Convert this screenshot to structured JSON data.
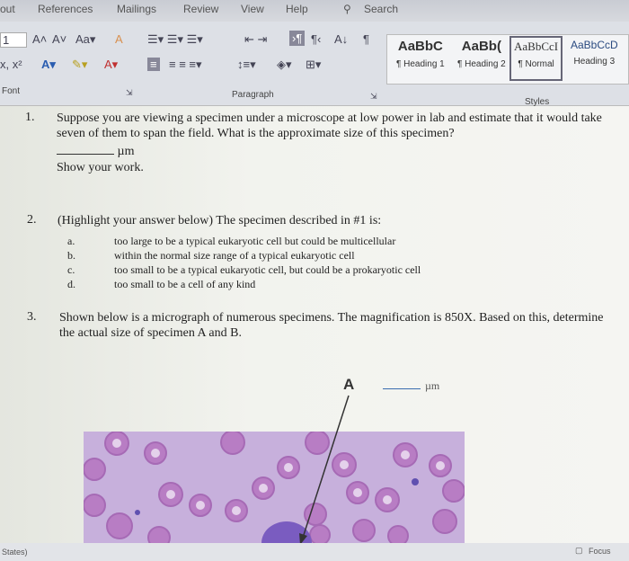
{
  "tabs": [
    "out",
    "References",
    "Mailings",
    "Review",
    "View",
    "Help"
  ],
  "search_label": "Search",
  "ribbon": {
    "font_size": "1",
    "groups": {
      "font": "Font",
      "paragraph": "Paragraph",
      "styles": "Styles"
    },
    "styles": [
      {
        "sample": "AaBbC",
        "name": "¶ Heading 1"
      },
      {
        "sample": "AaBb(",
        "name": "¶ Heading 2"
      },
      {
        "sample": "AaBbCcI",
        "name": "¶ Normal",
        "selected": true
      },
      {
        "sample": "AaBbCcD",
        "name": "Heading 3"
      }
    ]
  },
  "document": {
    "q1": {
      "num": "1.",
      "text": "Suppose you are viewing a specimen under a microscope at low power in lab and estimate that it would take seven of them to span the field. What is the approximate size of this specimen?",
      "unit": "µm",
      "show": "Show your work."
    },
    "q2": {
      "num": "2.",
      "text": "(Highlight your answer below) The specimen described in #1 is:",
      "options": [
        {
          "letter": "a.",
          "text": "too large to be a typical eukaryotic cell but could be multicellular"
        },
        {
          "letter": "b.",
          "text": "within the normal size range of a typical eukaryotic cell"
        },
        {
          "letter": "c.",
          "text": "too small to be a typical eukaryotic cell, but could be a prokaryotic cell"
        },
        {
          "letter": "d.",
          "text": "too small to be a cell of any kind"
        }
      ]
    },
    "q3": {
      "num": "3.",
      "text": "Shown below is a micrograph of numerous specimens.  The magnification is 850X.  Based on this, determine the actual size of specimen A and B."
    },
    "label_a": "A",
    "unit_a": "µm"
  },
  "status": {
    "language": "States)",
    "focus": "Focus"
  }
}
